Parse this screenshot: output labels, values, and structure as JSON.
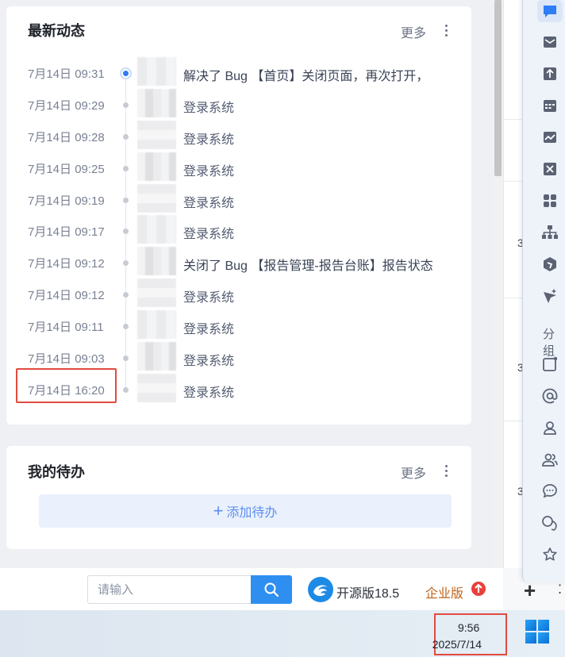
{
  "activity": {
    "title": "最新动态",
    "more": "更多",
    "items": [
      {
        "time": "7月14日 09:31",
        "text": "解决了 Bug 【首页】关闭页面，再次打开，"
      },
      {
        "time": "7月14日 09:29",
        "text": "登录系统"
      },
      {
        "time": "7月14日 09:28",
        "text": "登录系统"
      },
      {
        "time": "7月14日 09:25",
        "text": "登录系统"
      },
      {
        "time": "7月14日 09:19",
        "text": "登录系统"
      },
      {
        "time": "7月14日 09:17",
        "text": "登录系统"
      },
      {
        "time": "7月14日 09:12",
        "text": "关闭了 Bug 【报告管理-报告台账】报告状态"
      },
      {
        "time": "7月14日 09:12",
        "text": "登录系统"
      },
      {
        "time": "7月14日 09:11",
        "text": "登录系统"
      },
      {
        "time": "7月14日 09:03",
        "text": "登录系统"
      },
      {
        "time": "7月14日 16:20",
        "text": "登录系统"
      }
    ]
  },
  "todo": {
    "title": "我的待办",
    "more": "更多",
    "add_label": "添加待办"
  },
  "search": {
    "placeholder": "请输入"
  },
  "brand": {
    "edition": "开源版18.5",
    "enterprise": "企业版"
  },
  "side_panel": {
    "group_label": "分组",
    "digits": [
      "3",
      "3",
      "3"
    ]
  },
  "taskbar": {
    "time": "9:56",
    "date": "2025/7/14"
  },
  "colors": {
    "accent": "#2e8ff0",
    "highlight": "#e14b3f",
    "enterprise": "#c0631b"
  }
}
